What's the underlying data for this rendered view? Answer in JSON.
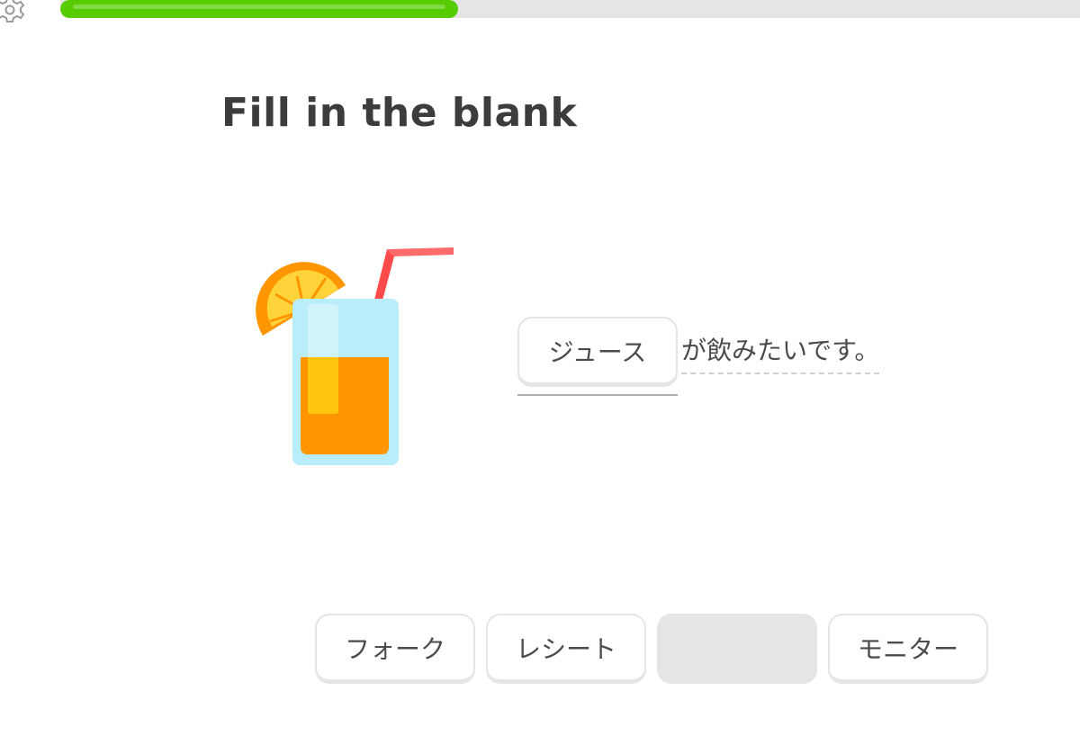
{
  "header": {
    "settings_icon": "gear-icon",
    "progress": 0.39
  },
  "challenge": {
    "title": "Fill in the blank",
    "image_icon": "juice-glass-icon",
    "blank_answer": "ジュース",
    "sentence_tail": "が飲みたいです。"
  },
  "word_bank": {
    "choices": [
      {
        "label": "フォーク",
        "used": false
      },
      {
        "label": "レシート",
        "used": false
      },
      {
        "label": "ジュース",
        "used": true
      },
      {
        "label": "モニター",
        "used": false
      }
    ]
  },
  "colors": {
    "progress_fill": "#58cc02",
    "progress_track": "#e5e5e5",
    "chip_border": "#e5e5e5",
    "title_text": "#3c3c3c"
  }
}
